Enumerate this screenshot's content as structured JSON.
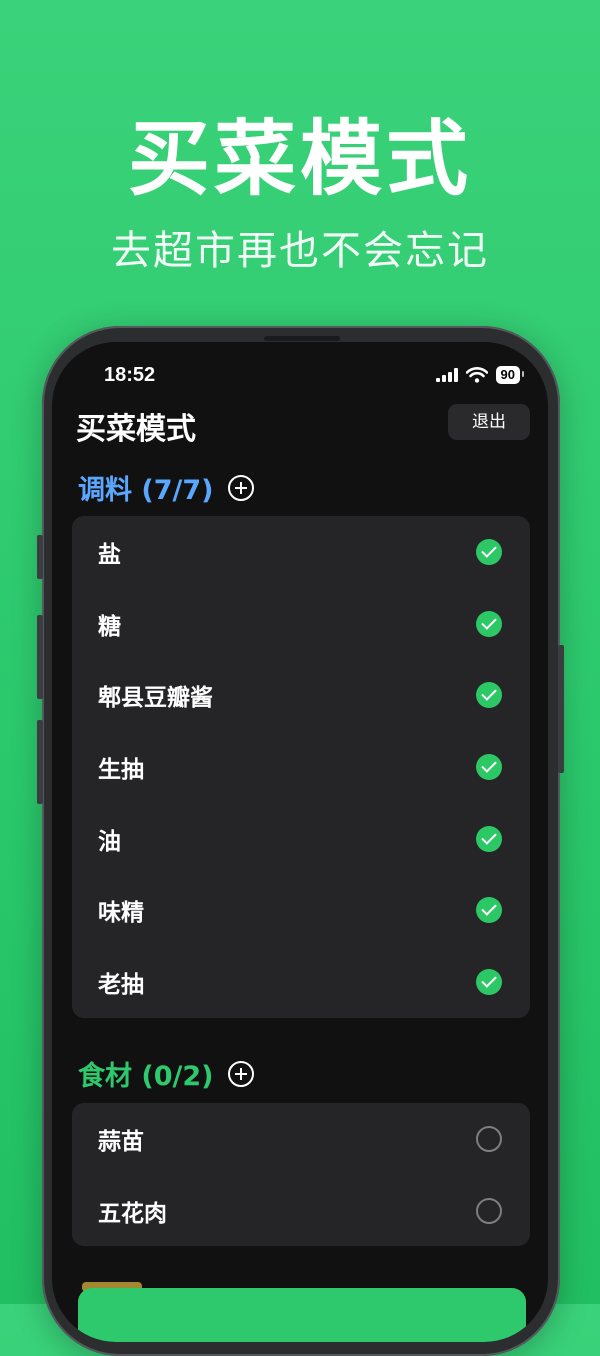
{
  "hero": {
    "title": "买菜模式",
    "subtitle": "去超市再也不会忘记"
  },
  "status": {
    "time": "18:52",
    "battery": "90"
  },
  "nav": {
    "title": "买菜模式",
    "exit_label": "退出"
  },
  "sections": [
    {
      "header": "调料 (7/7)",
      "color": "#5aa7ff",
      "items": [
        {
          "label": "盐",
          "checked": true
        },
        {
          "label": "糖",
          "checked": true
        },
        {
          "label": "郫县豆瓣酱",
          "checked": true
        },
        {
          "label": "生抽",
          "checked": true
        },
        {
          "label": "油",
          "checked": true
        },
        {
          "label": "味精",
          "checked": true
        },
        {
          "label": "老抽",
          "checked": true
        }
      ]
    },
    {
      "header": "食材 (0/2)",
      "color": "#2ec96d",
      "items": [
        {
          "label": "蒜苗",
          "checked": false
        },
        {
          "label": "五花肉",
          "checked": false
        }
      ]
    }
  ],
  "colors": {
    "background": "#2cc86c",
    "checked": "#2dc866",
    "screen": "#111111"
  }
}
